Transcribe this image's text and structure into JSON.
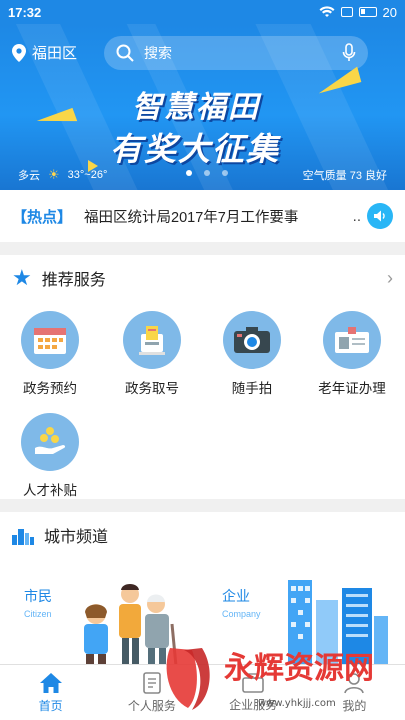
{
  "status_bar": {
    "time": "17:32",
    "battery": "20"
  },
  "header": {
    "location": "福田区",
    "search_placeholder": "搜索"
  },
  "banner": {
    "headline_line1": "智慧福田",
    "headline_line2": "有奖大征集",
    "weather": {
      "condition": "多云",
      "temperature": "33°~26°"
    },
    "air_quality": "空气质量 73 良好",
    "page_count": 3,
    "active_page": 1
  },
  "hot_news": {
    "tag": "【热点】",
    "text": "福田区统计局2017年7月工作要事",
    "ellipsis": ".."
  },
  "recommended": {
    "title": "推荐服务",
    "items": [
      {
        "label": "政务预约",
        "icon": "calendar-icon"
      },
      {
        "label": "政务取号",
        "icon": "ticket-machine-icon"
      },
      {
        "label": "随手拍",
        "icon": "camera-icon"
      },
      {
        "label": "老年证办理",
        "icon": "id-card-icon"
      },
      {
        "label": "人才补贴",
        "icon": "coins-hand-icon"
      }
    ]
  },
  "city_channel": {
    "title": "城市频道",
    "citizen": {
      "label": "市民",
      "sub": "Citizen"
    },
    "company": {
      "label": "企业",
      "sub": "Company"
    }
  },
  "bottom_nav": [
    {
      "label": "首页",
      "icon": "home-icon",
      "active": true
    },
    {
      "label": "个人服务",
      "icon": "document-icon",
      "active": false
    },
    {
      "label": "企业服务",
      "icon": "briefcase-icon",
      "active": false
    },
    {
      "label": "我的",
      "icon": "user-icon",
      "active": false
    }
  ],
  "watermark": {
    "brand": "永辉资源网",
    "url": "www.yhkjjj.com"
  },
  "colors": {
    "primary": "#1e88e5",
    "icon_circle": "#7fb9e8",
    "accent_yellow": "#f9d648"
  }
}
